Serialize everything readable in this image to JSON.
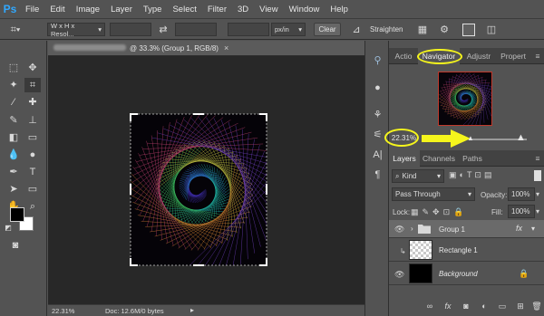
{
  "app": {
    "logo": "Ps",
    "accent": "#31a8ff"
  },
  "menu": [
    "File",
    "Edit",
    "Image",
    "Layer",
    "Type",
    "Select",
    "Filter",
    "3D",
    "View",
    "Window",
    "Help"
  ],
  "options": {
    "ratio_value": "W x H x Resol...",
    "units_value": "px/in",
    "clear_label": "Clear",
    "straighten_label": "Straighten"
  },
  "document": {
    "tab_title": "@ 33.3% (Group 1, RGB/8)",
    "close_glyph": "×",
    "zoom": "22.31%",
    "doc_info": "Doc: 12.6M/0 bytes"
  },
  "panels": {
    "top_tabs": [
      "Actio",
      "Navigator",
      "Adjustr",
      "Propert"
    ],
    "active_top_tab": "Navigator",
    "navigator_zoom": "22.31%",
    "layer_tabs": [
      "Layers",
      "Channels",
      "Paths"
    ],
    "filter_kind": "Kind",
    "blend_mode": "Pass Through",
    "opacity_label": "Opacity:",
    "opacity_value": "100%",
    "lock_label": "Lock:",
    "fill_label": "Fill:",
    "fill_value": "100%",
    "fx_label": "fx",
    "layers": [
      {
        "name": "Group 1",
        "type": "group",
        "visible": true
      },
      {
        "name": "Rectangle 1",
        "type": "shape",
        "visible": false
      },
      {
        "name": "Background",
        "type": "background",
        "visible": true,
        "locked": true
      }
    ]
  },
  "annotation": {
    "color": "#f5f51c"
  }
}
